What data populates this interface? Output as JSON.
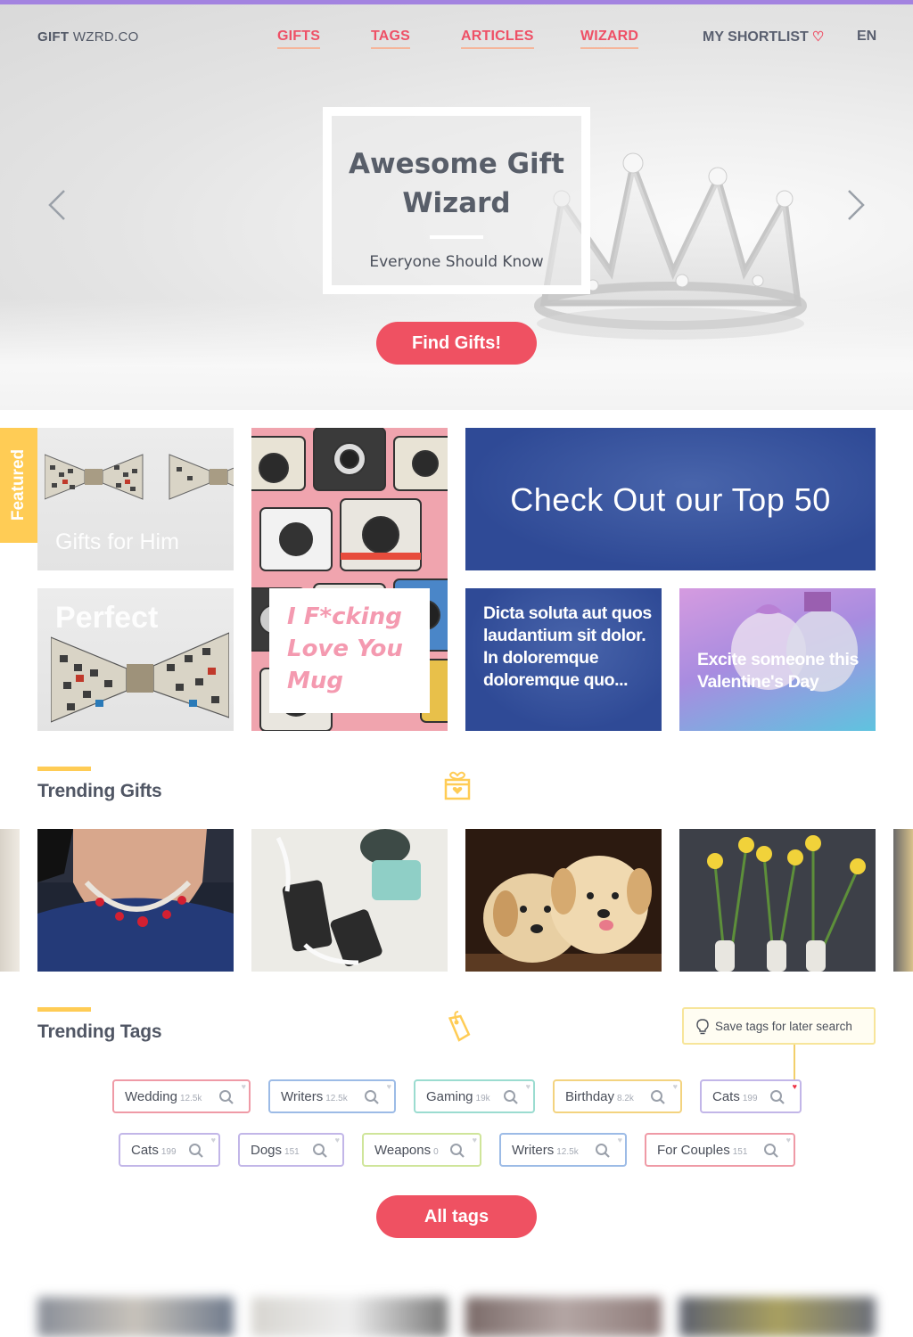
{
  "brand": {
    "bold": "GIFT",
    "rest": "WZRD.CO"
  },
  "nav": {
    "links": [
      "GIFTS",
      "TAGS",
      "ARTICLES",
      "WIZARD"
    ],
    "shortlist": "MY SHORTLIST",
    "language": "EN"
  },
  "hero": {
    "title": "Awesome Gift Wizard",
    "subtitle": "Everyone Should Know",
    "cta": "Find Gifts!"
  },
  "featured": {
    "tab_label": "Featured",
    "tiles": {
      "gifts_for_him": "Gifts for Him",
      "perfect": "Perfect",
      "mug": "I F*cking Love You Mug",
      "top50": "Check Out our Top 50",
      "article": "Dicta soluta aut quos laudantium sit dolor. In doloremque doloremque quo...",
      "valentine": "Excite someone this Valentine's Day"
    }
  },
  "trending_gifts": {
    "title": "Trending Gifts"
  },
  "trending_tags": {
    "title": "Trending Tags",
    "tip": "Save tags for later search",
    "tags": [
      {
        "name": "Wedding",
        "count": "12.5k",
        "color": "#ef9aa6",
        "fav": false
      },
      {
        "name": "Writers",
        "count": "12.5k",
        "color": "#9cbbe6",
        "fav": false
      },
      {
        "name": "Gaming",
        "count": "19k",
        "color": "#9bdcd0",
        "fav": false
      },
      {
        "name": "Birthday",
        "count": "8.2k",
        "color": "#f3d37f",
        "fav": false
      },
      {
        "name": "Cats",
        "count": "199",
        "color": "#c2b6e8",
        "fav": true
      },
      {
        "name": "Cats",
        "count": "199",
        "color": "#c2b6e8",
        "fav": false
      },
      {
        "name": "Dogs",
        "count": "151",
        "color": "#c2b6e8",
        "fav": false
      },
      {
        "name": "Weapons",
        "count": "0",
        "color": "#cfe59a",
        "fav": false
      },
      {
        "name": "Writers",
        "count": "12.5k",
        "color": "#9cbbe6",
        "fav": false
      },
      {
        "name": "For Couples",
        "count": "151",
        "color": "#ef9aa6",
        "fav": false
      }
    ],
    "all_button": "All tags"
  },
  "colors": {
    "accent": "#ef5162",
    "highlight": "#ffcc55",
    "top_bar": "#a383e0",
    "blue_tile": "#2f4a96"
  },
  "icons": [
    "chevron-left-icon",
    "chevron-right-icon",
    "heart-icon",
    "gift-box-icon",
    "tag-icon",
    "lightbulb-icon",
    "search-icon"
  ]
}
